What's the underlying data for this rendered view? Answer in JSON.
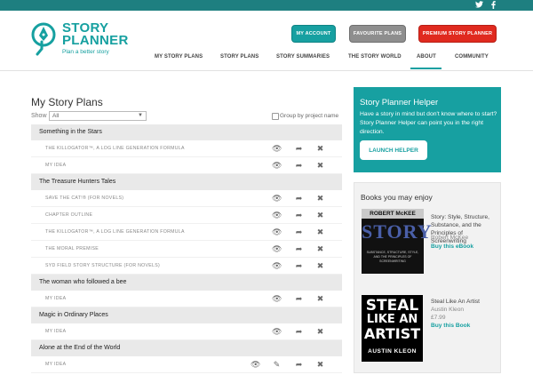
{
  "social": {
    "twitter_icon": "twitter-icon",
    "facebook_icon": "facebook-icon"
  },
  "brand": {
    "line1": "STORY",
    "line2": "PLANNER",
    "tagline": "Plan a better story",
    "color": "#16a0a0"
  },
  "header_buttons": {
    "account": "MY ACCOUNT",
    "favourites": "FAVOURITE PLANS",
    "premium": "PREMIUM STORY PLANNER"
  },
  "nav": [
    "MY STORY PLANS",
    "STORY PLANS",
    "STORY SUMMARIES",
    "THE STORY WORLD",
    "ABOUT",
    "COMMUNITY"
  ],
  "main": {
    "title": "My Story Plans",
    "show_label": "Show",
    "show_value": "All",
    "group_label": "Group by project name"
  },
  "projects": [
    {
      "name": "Something in the Stars",
      "items": [
        "THE KILLOGATOR™, A LOG LINE GENERATION FORMULA",
        "MY IDEA"
      ]
    },
    {
      "name": "The Treasure Hunters Tales",
      "items": [
        "SAVE THE CAT!® (FOR NOVELS)",
        "CHAPTER OUTLINE",
        "THE KILLOGATOR™, A LOG LINE GENERATION FORMULA",
        "THE MORAL PREMISE",
        "SYD FIELD STORY STRUCTURE (FOR NOVELS)"
      ]
    },
    {
      "name": "The woman who followed a bee",
      "items": [
        "MY IDEA"
      ]
    },
    {
      "name": "Magic in Ordinary Places",
      "items": [
        "MY IDEA"
      ]
    },
    {
      "name": "Alone at the End of the World",
      "items": [
        "MY IDEA"
      ]
    }
  ],
  "helper": {
    "title": "Story Planner Helper",
    "description": "Have a story in mind but don't know where to start? Story Planner Helper can point you in the right direction.",
    "button": "LAUNCH HELPER",
    "color": "#17a0a1"
  },
  "books": {
    "title": "Books you may enjoy",
    "items": [
      {
        "title": "Story: Style, Structure, Substance, and the Principles of Screenwriting",
        "author": "Robert McKee",
        "buy": "Buy this eBook",
        "cover_author": "ROBERT McKEE",
        "cover_title": "STORY",
        "cover_sub": "SUBSTANCE, STRUCTURE, STYLE, AND THE PRINCIPLES OF SCREENWRITING"
      },
      {
        "title": "Steal Like An Artist",
        "author": "Austin Kleon",
        "price": "£7.99",
        "buy": "Buy this Book",
        "cover_l1": "STEAL",
        "cover_l2": "LIKE AN",
        "cover_l3": "ARTIST",
        "cover_author": "AUSTIN KLEON"
      }
    ]
  }
}
